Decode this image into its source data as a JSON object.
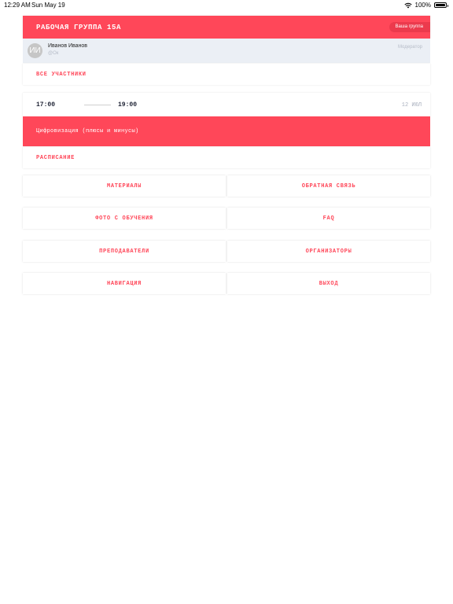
{
  "status_bar": {
    "time": "12:29 AM",
    "date": "Sun May 19",
    "battery": "100%"
  },
  "group": {
    "title": "РАБОЧАЯ ГРУППА 15А",
    "badge": "Ваша группа"
  },
  "user": {
    "initials": "ИИ",
    "name": "Иванов Иванов",
    "handle": "@Ок",
    "role": "Модератор"
  },
  "all_members_label": "ВСЕ УЧАСТНИКИ",
  "event": {
    "start": "17:00",
    "end": "19:00",
    "date": "12 ИЮЛ",
    "title": "Цифровизация (плюсы и минусы)"
  },
  "schedule_label": "РАСПИСАНИЕ",
  "menu": {
    "materials": "МАТЕРИАЛЫ",
    "feedback": "ОБРАТНАЯ СВЯЗЬ",
    "photos": "ФОТО С ОБУЧЕНИЯ",
    "faq": "FAQ",
    "teachers": "ПРЕПОДАВАТЕЛИ",
    "organizers": "ОРГАНИЗАТОРЫ",
    "navigation": "НАВИГАЦИЯ",
    "logout": "ВЫХОД"
  },
  "colors": {
    "accent": "#ff4759",
    "user_row_bg": "#ebeff5",
    "muted_text": "#b6bcc8"
  }
}
